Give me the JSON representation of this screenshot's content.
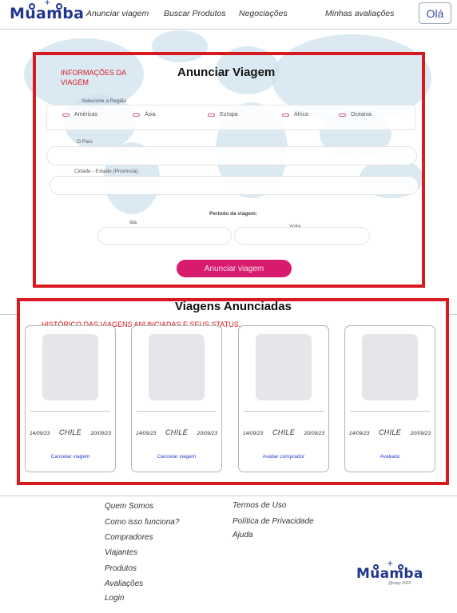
{
  "header": {
    "logo": "Muamba",
    "nav": [
      "Anunciar viagem",
      "Buscar Produtos",
      "Negociações",
      "Minhas avaliações"
    ],
    "user_button": "Olá"
  },
  "form": {
    "annotation": "INFORMAÇÕES DA VIAGEM",
    "title": "Anunciar Viagem",
    "region_label": "Selecione a Região",
    "regions": [
      "Américas",
      "Ásia",
      "Europa",
      "África",
      "Oceania"
    ],
    "country_label": "O País",
    "city_label": "Cidade - Estado (Província)",
    "period_label": "Período da viagem:",
    "departure_label": "Ida",
    "return_label": "Volta",
    "submit": "Anunciar viagem",
    "accent_color": "#d81b6d"
  },
  "history": {
    "title": "Viagens Anunciadas",
    "annotation": "HISTÓRICO DAS VIAGENS ANUNCIADAS E SEUS STATUS.",
    "trips": [
      {
        "start": "14/09/23",
        "country": "CHILE",
        "end": "20/09/23",
        "action": "Cancelar viagem"
      },
      {
        "start": "14/09/23",
        "country": "CHILE",
        "end": "20/09/23",
        "action": "Cancelar viagem"
      },
      {
        "start": "14/09/23",
        "country": "CHILE",
        "end": "20/09/23",
        "action": "Avaliar comprador"
      },
      {
        "start": "14/09/23",
        "country": "CHILE",
        "end": "20/09/23",
        "action": "Avaliado"
      }
    ]
  },
  "footer": {
    "col1": [
      "Quem Somos",
      "Como isso funciona?",
      "Compradores",
      "Viajantes",
      "Produtos",
      "Avaliações",
      "Login"
    ],
    "col2": [
      "Termos de Uso",
      "Política de Privacidade",
      "Ajuda"
    ],
    "logo": "Muamba",
    "copyright": "@copy 2023"
  },
  "colors": {
    "brand": "#23368f",
    "annotation_red": "#d71920",
    "link_blue": "#2c3fd0"
  }
}
